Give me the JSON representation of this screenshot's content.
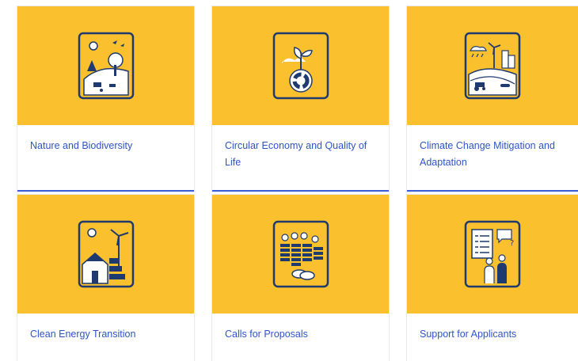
{
  "cards": [
    {
      "label": "Nature and Biodiversity",
      "icon": "nature-biodiversity-icon"
    },
    {
      "label": "Circular Economy and Quality of Life",
      "icon": "circular-economy-icon"
    },
    {
      "label": "Climate Change Mitigation and Adaptation",
      "icon": "climate-change-icon"
    },
    {
      "label": "Clean Energy Transition",
      "icon": "clean-energy-icon"
    },
    {
      "label": "Calls for Proposals",
      "icon": "calls-for-proposals-icon"
    },
    {
      "label": "Support for Applicants",
      "icon": "support-applicants-icon"
    }
  ],
  "colors": {
    "card_image_bg": "#fbc02d",
    "link": "#2f54c9",
    "icon_stroke": "#1e3a6e",
    "accent_border": "#3a5fd6"
  }
}
